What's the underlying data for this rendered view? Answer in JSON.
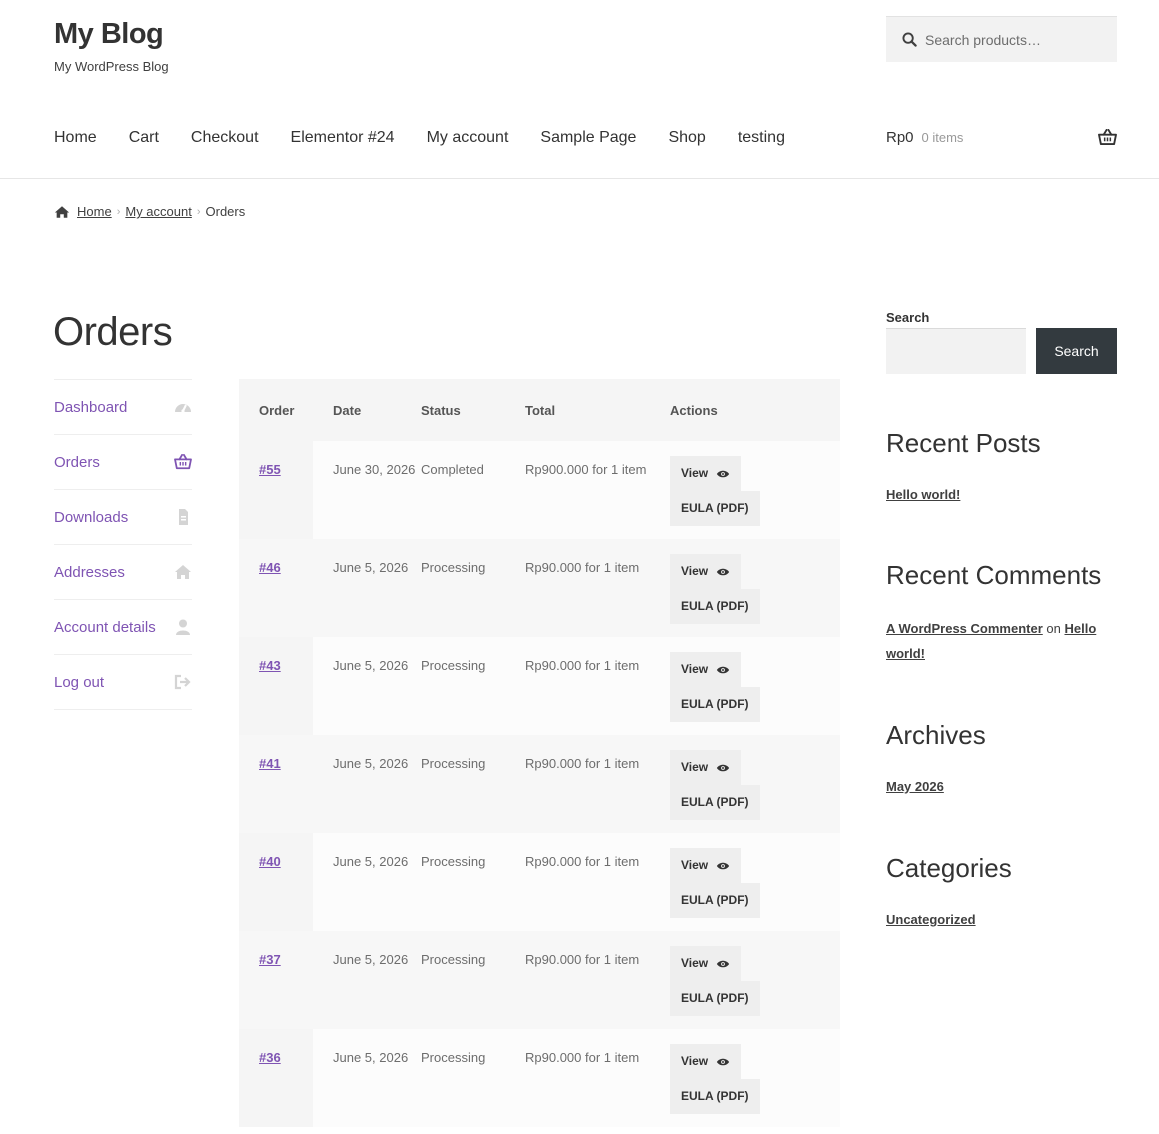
{
  "site": {
    "title": "My Blog",
    "description": "My WordPress Blog"
  },
  "header_search": {
    "placeholder": "Search products…"
  },
  "main_nav": [
    "Home",
    "Cart",
    "Checkout",
    "Elementor #24",
    "My account",
    "Sample Page",
    "Shop",
    "testing"
  ],
  "cart": {
    "amount": "Rp0",
    "count": "0 items"
  },
  "breadcrumb": {
    "home": "Home",
    "my_account": "My account",
    "current": "Orders"
  },
  "page_title": "Orders",
  "account_nav": [
    {
      "label": "Dashboard",
      "icon": "dashboard-icon"
    },
    {
      "label": "Orders",
      "icon": "basket-icon"
    },
    {
      "label": "Downloads",
      "icon": "file-icon"
    },
    {
      "label": "Addresses",
      "icon": "home-icon"
    },
    {
      "label": "Account details",
      "icon": "user-icon"
    },
    {
      "label": "Log out",
      "icon": "logout-icon"
    }
  ],
  "orders_table": {
    "headers": [
      "Order",
      "Date",
      "Status",
      "Total",
      "Actions"
    ],
    "view_label": "View",
    "eula_label": "EULA (PDF)",
    "rows": [
      {
        "order": "#55",
        "date": "June 30, 2026",
        "status": "Completed",
        "total": "Rp900.000 for 1 item"
      },
      {
        "order": "#46",
        "date": "June 5, 2026",
        "status": "Processing",
        "total": "Rp90.000 for 1 item"
      },
      {
        "order": "#43",
        "date": "June 5, 2026",
        "status": "Processing",
        "total": "Rp90.000 for 1 item"
      },
      {
        "order": "#41",
        "date": "June 5, 2026",
        "status": "Processing",
        "total": "Rp90.000 for 1 item"
      },
      {
        "order": "#40",
        "date": "June 5, 2026",
        "status": "Processing",
        "total": "Rp90.000 for 1 item"
      },
      {
        "order": "#37",
        "date": "June 5, 2026",
        "status": "Processing",
        "total": "Rp90.000 for 1 item"
      },
      {
        "order": "#36",
        "date": "June 5, 2026",
        "status": "Processing",
        "total": "Rp90.000 for 1 item"
      }
    ]
  },
  "sidebar": {
    "search_label": "Search",
    "search_button": "Search",
    "recent_posts_title": "Recent Posts",
    "recent_post": "Hello world!",
    "recent_comments_title": "Recent Comments",
    "comment_author": "A WordPress Commenter",
    "comment_on": "on",
    "comment_post": "Hello world!",
    "archives_title": "Archives",
    "archive": "May 2026",
    "categories_title": "Categories",
    "category": "Uncategorized"
  },
  "colors": {
    "accent": "#7f54b3",
    "button_dark": "#333a3f",
    "text": "#404040"
  }
}
